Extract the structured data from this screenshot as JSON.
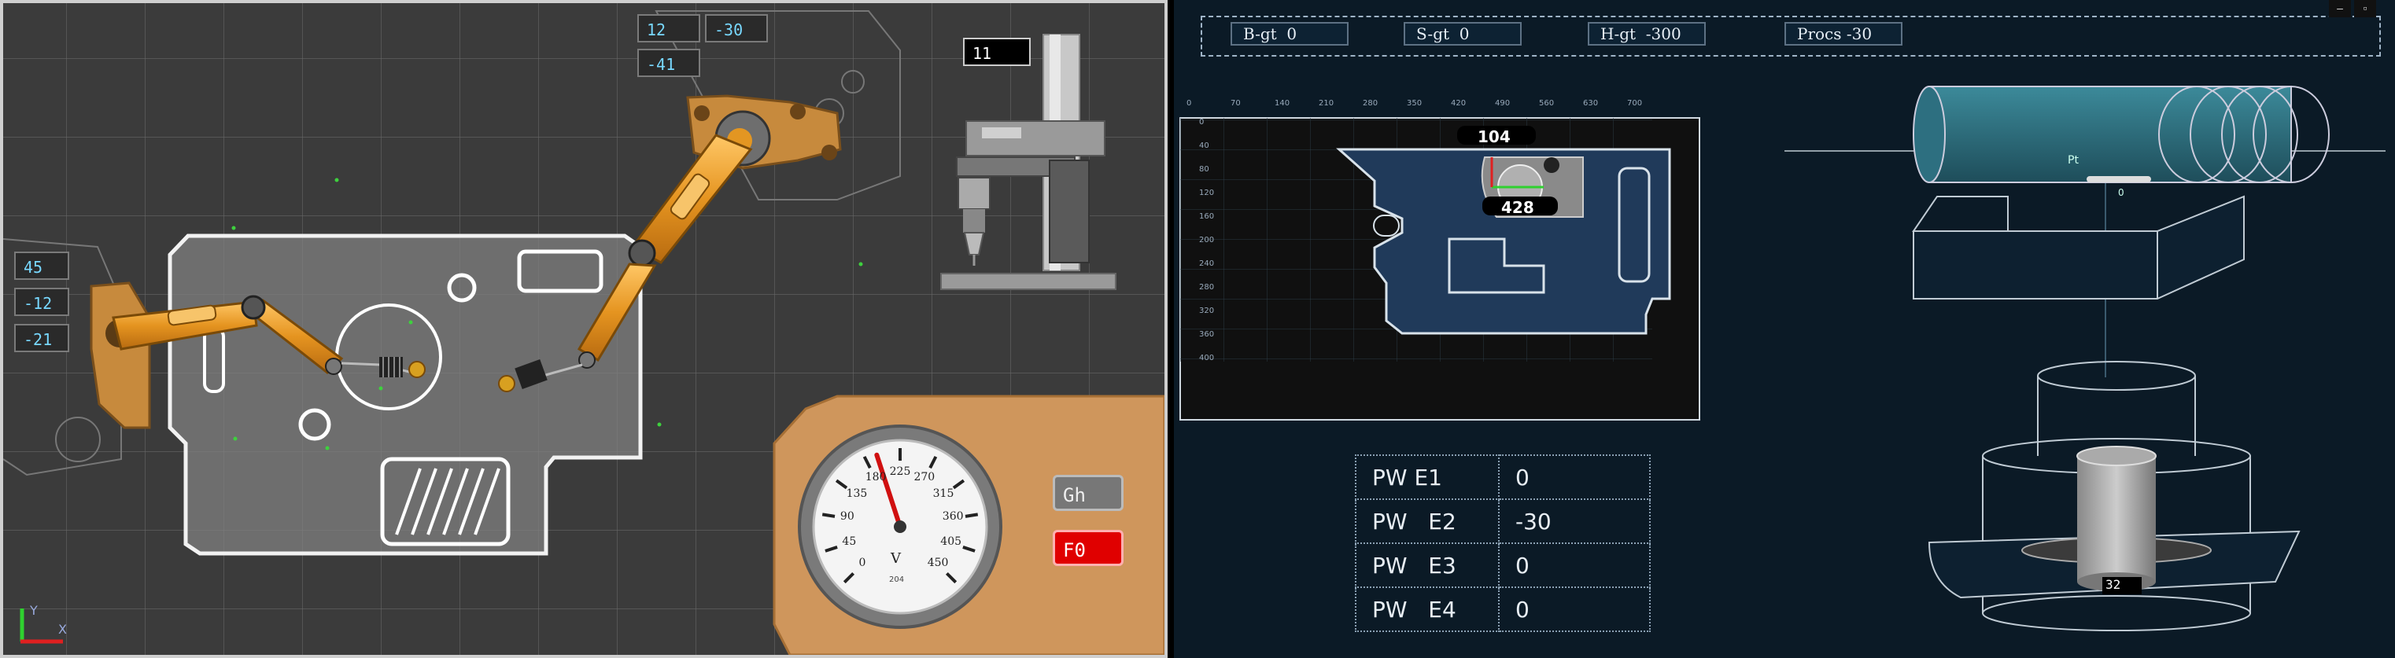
{
  "left_view": {
    "readouts": {
      "top_a": "12",
      "top_b": "-30",
      "top_c": "-41",
      "left_a": "45",
      "left_b": "-12",
      "left_c": "-21",
      "counter": "11"
    },
    "axis": {
      "y": "Y",
      "x": "X"
    },
    "gauge": {
      "ticks": [
        "0",
        "45",
        "90",
        "135",
        "180",
        "225",
        "270",
        "315",
        "360",
        "405",
        "450"
      ],
      "unit": "V",
      "reading": "204",
      "needle_value": 195
    },
    "buttons": {
      "gh": "Gh",
      "f0": "F0"
    },
    "colors": {
      "bg": "#3a3a3a",
      "arm": "#f0a531",
      "bracket": "#c78a3d",
      "gauge_panel": "#cf965c",
      "f0_button": "#e00000"
    }
  },
  "right_view": {
    "hud": [
      {
        "label": "B-gt",
        "value": "0"
      },
      {
        "label": "S-gt",
        "value": "0"
      },
      {
        "label": "H-gt",
        "value": "-300"
      },
      {
        "label": "Procs",
        "value": "-30"
      }
    ],
    "map": {
      "x_ticks": [
        "0",
        "70",
        "140",
        "210",
        "280",
        "350",
        "420",
        "490",
        "560",
        "630",
        "700"
      ],
      "y_ticks": [
        "0",
        "40",
        "80",
        "120",
        "160",
        "200",
        "240",
        "280",
        "320",
        "360",
        "400"
      ],
      "marker_top": "104",
      "marker_bottom": "428"
    },
    "pw_table": [
      {
        "key": "PW E1",
        "value": "0"
      },
      {
        "key": "PW   E2",
        "value": "-30"
      },
      {
        "key": "PW   E3",
        "value": "0"
      },
      {
        "key": "PW   E4",
        "value": "0"
      }
    ],
    "iso": {
      "label_pt": "Pt",
      "label_0": "0",
      "counter": "32"
    },
    "window_controls": {
      "minimize": "–",
      "restore": "▫"
    },
    "colors": {
      "bg": "#0b1a26",
      "plate": "#203a5a",
      "cylinder": "#2d6f80"
    }
  }
}
